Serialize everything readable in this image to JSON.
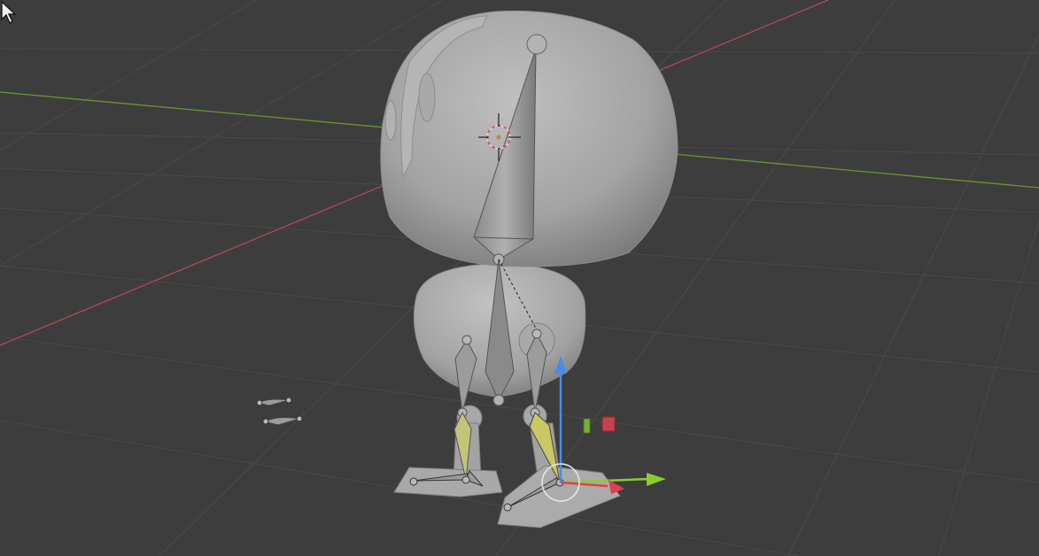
{
  "viewport": {
    "mode": "pose",
    "background_color": "#3d3d3d",
    "grid_color": "#4a4a4a",
    "x_axis_color": "#c0505a",
    "y_axis_color": "#74a032"
  },
  "scene": {
    "object": "robot-character",
    "armature": "armature-rig",
    "selected_bone": "right-shin-bone",
    "selected_color": "#c8c864",
    "mesh_color": "#a6a6a6"
  },
  "gizmo": {
    "type": "move-gizmo",
    "x_color": "#e04050",
    "y_color": "#8ccc30",
    "z_color": "#4a8ae8"
  },
  "cursor": {
    "icon": "arrow-cursor"
  }
}
